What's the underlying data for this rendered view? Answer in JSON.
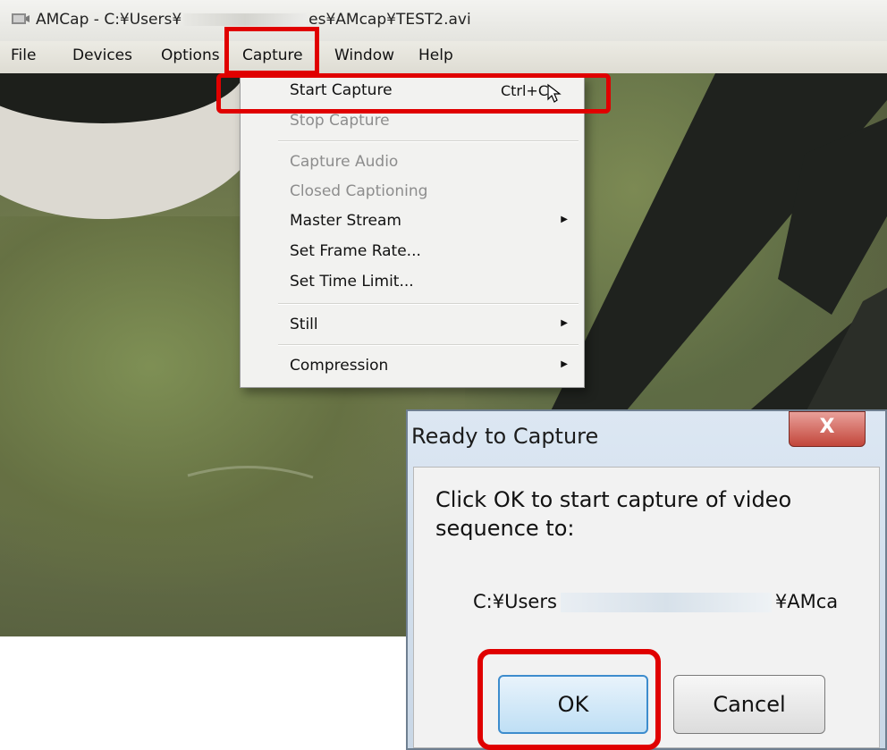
{
  "window": {
    "title": "AMCap - C:¥Users¥",
    "title_tail": "es¥AMcap¥TEST2.avi"
  },
  "menubar": {
    "items": [
      "File",
      "Devices",
      "Options",
      "Capture",
      "Window",
      "Help"
    ]
  },
  "capture_menu": {
    "items": [
      {
        "label": "Start Capture",
        "shortcut": "Ctrl+C",
        "enabled": true
      },
      {
        "label": "Stop Capture",
        "enabled": false
      },
      {
        "label": "Capture Audio",
        "enabled": false
      },
      {
        "label": "Closed Captioning",
        "enabled": false
      },
      {
        "label": "Master Stream",
        "enabled": true,
        "submenu": true
      },
      {
        "label": "Set Frame Rate...",
        "enabled": true
      },
      {
        "label": "Set Time Limit...",
        "enabled": true
      },
      {
        "label": "Still",
        "enabled": true,
        "submenu": true
      },
      {
        "label": "Compression",
        "enabled": true,
        "submenu": true
      }
    ]
  },
  "dialog": {
    "title": "Ready to Capture",
    "close_glyph": "X",
    "message": "Click OK to start capture of video sequence to:",
    "path_start": "C:¥Users",
    "path_end": "¥AMca",
    "ok_label": "OK",
    "cancel_label": "Cancel"
  },
  "colors": {
    "highlight": "#e00000",
    "ok_border": "#3d8ccd"
  }
}
